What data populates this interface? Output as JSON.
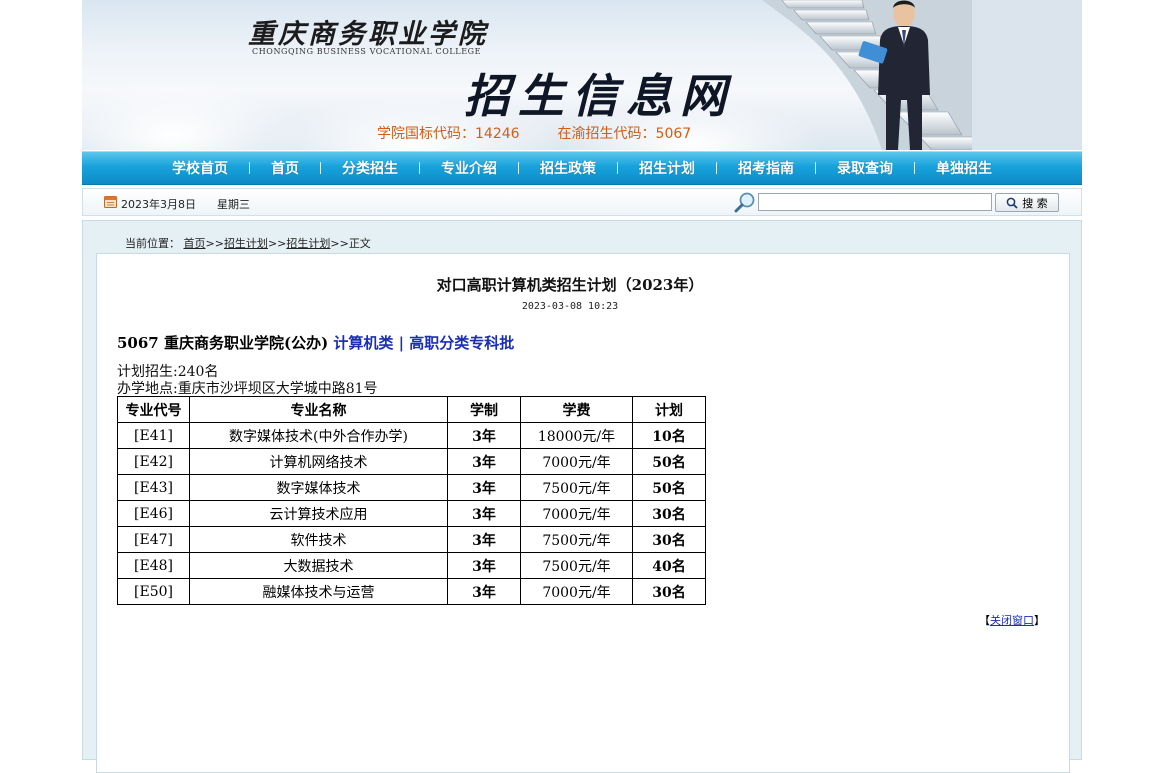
{
  "banner": {
    "college_name": "重庆商务职业学院",
    "college_name_en": "CHONGQING BUSINESS VOCATIONAL COLLEGE",
    "site_title": "招生信息网",
    "national_code": "学院国标代码：14246",
    "local_code": "在渝招生代码：5067"
  },
  "nav": {
    "items": [
      "学校首页",
      "首页",
      "分类招生",
      "专业介绍",
      "招生政策",
      "招生计划",
      "招考指南",
      "录取查询",
      "单独招生"
    ]
  },
  "datebar": {
    "date": "2023年3月8日",
    "weekday": "星期三",
    "search_value": "",
    "search_button": "搜 索"
  },
  "breadcrumb": {
    "prefix": "当前位置：",
    "links": [
      "首页",
      "招生计划",
      "招生计划"
    ],
    "current": "正文"
  },
  "article": {
    "title": "对口高职计算机类招生计划（2023年）",
    "datetime": "2023-03-08 10:23",
    "school": "5067 重庆商务职业学院(公办)",
    "category": "计算机类 | 高职分类专科批",
    "plan_total": "计划招生:240名",
    "address": "办学地点:重庆市沙坪坝区大学城中路81号",
    "table": {
      "headers": [
        "专业代号",
        "专业名称",
        "学制",
        "学费",
        "计划"
      ],
      "rows": [
        [
          "[E41]",
          "数字媒体技术(中外合作办学)",
          "3年",
          "18000元/年",
          "10名"
        ],
        [
          "[E42]",
          "计算机网络技术",
          "3年",
          "7000元/年",
          "50名"
        ],
        [
          "[E43]",
          "数字媒体技术",
          "3年",
          "7500元/年",
          "50名"
        ],
        [
          "[E46]",
          "云计算技术应用",
          "3年",
          "7000元/年",
          "30名"
        ],
        [
          "[E47]",
          "软件技术",
          "3年",
          "7500元/年",
          "30名"
        ],
        [
          "[E48]",
          "大数据技术",
          "3年",
          "7500元/年",
          "40名"
        ],
        [
          "[E50]",
          "融媒体技术与运营",
          "3年",
          "7000元/年",
          "30名"
        ]
      ]
    },
    "close_bracket_left": "【",
    "close_label": "关闭窗口",
    "close_bracket_right": "】"
  },
  "colors": {
    "nav_blue": "#18a2dc",
    "code_orange": "#d35d14",
    "link_blue": "#1a2fb5",
    "content_bg": "#e5f0f4"
  }
}
